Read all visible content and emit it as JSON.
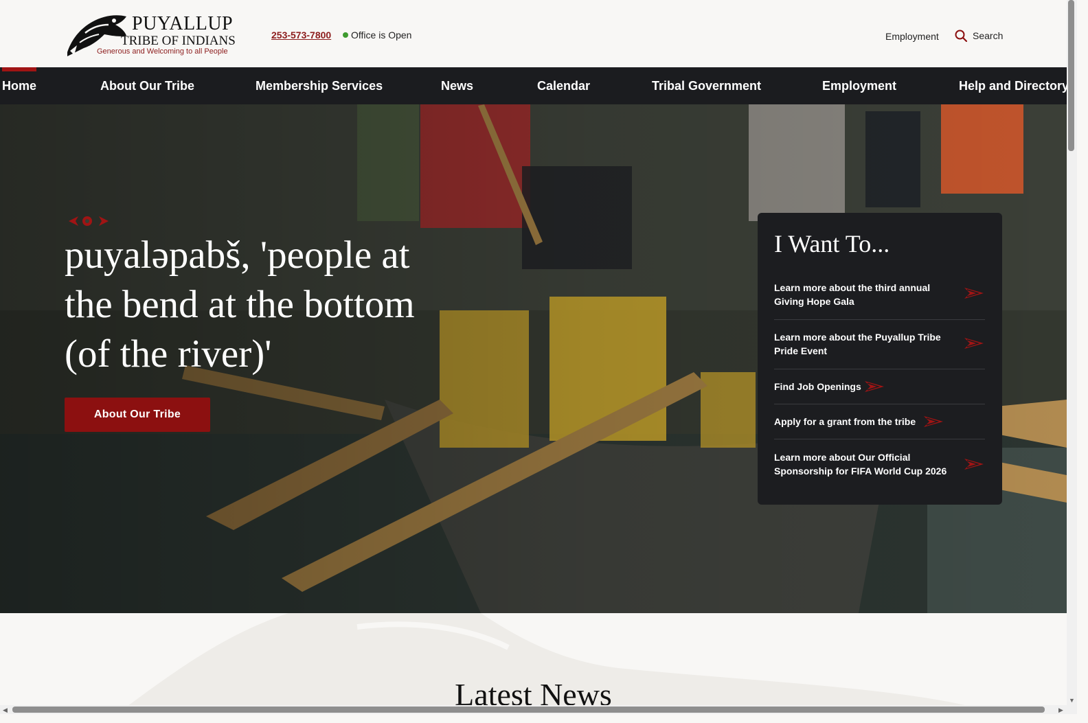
{
  "header": {
    "logo": {
      "name": "PUYALLUP",
      "subtitle": "TRIBE OF INDIANS",
      "tagline": "Generous and Welcoming to all People"
    },
    "phone": "253-573-7800",
    "office_status": "Office is Open",
    "employment_link": "Employment",
    "search_label": "Search"
  },
  "nav": {
    "items": [
      {
        "label": "Home",
        "active": true
      },
      {
        "label": "About Our Tribe"
      },
      {
        "label": "Membership Services"
      },
      {
        "label": "News"
      },
      {
        "label": "Calendar"
      },
      {
        "label": "Tribal Government"
      },
      {
        "label": "Employment"
      },
      {
        "label": "Help and Directory"
      }
    ]
  },
  "hero": {
    "title": "puyaləpabš, 'people at the bend at the bottom (of the river)'",
    "button_label": "About Our Tribe"
  },
  "i_want_to": {
    "title": "I Want To...",
    "items": [
      {
        "label": "Learn more about the third annual Giving Hope Gala"
      },
      {
        "label": "Learn more about the Puyallup Tribe Pride Event"
      },
      {
        "label": "Find Job Openings"
      },
      {
        "label": "Apply for a grant from the tribe"
      },
      {
        "label": "Learn more about Our Official Sponsorship for FIFA World Cup 2026"
      }
    ]
  },
  "latest_news": {
    "title": "Latest News"
  },
  "colors": {
    "accent": "#8c1010",
    "nav_bg": "#1b1c1f",
    "panel_bg": "#1c1d20",
    "status_green": "#3e9b2f"
  }
}
